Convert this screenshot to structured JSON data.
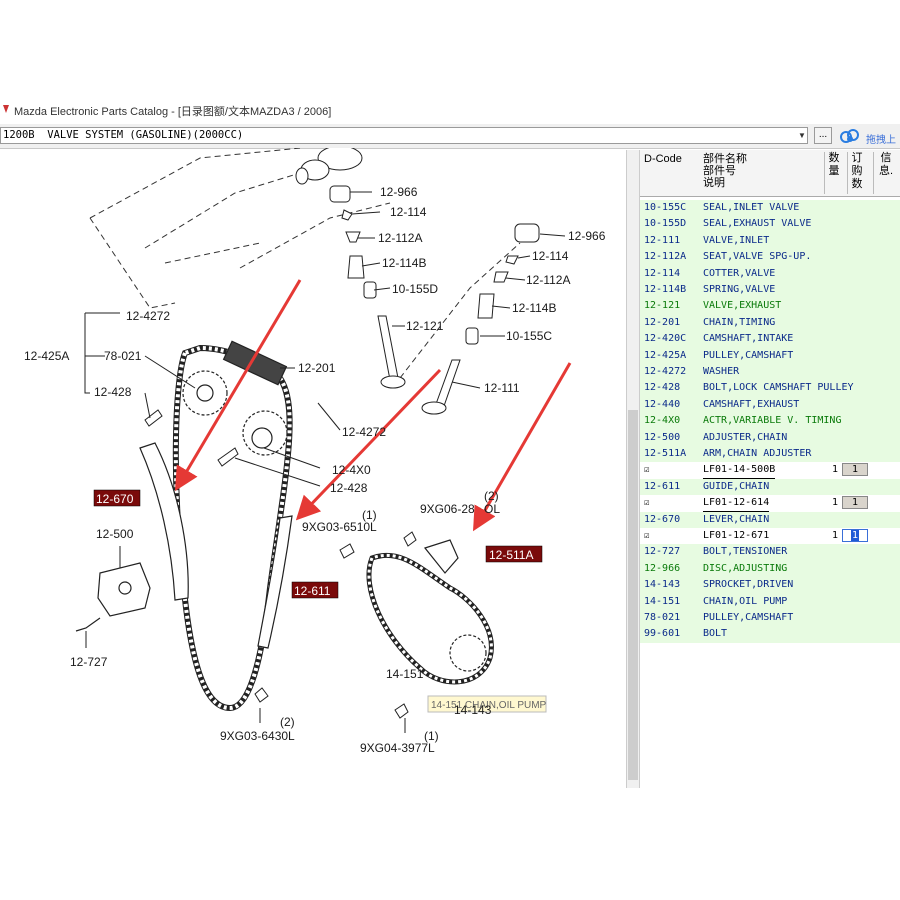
{
  "window": {
    "title": "Mazda Electronic Parts Catalog - [日录图额/文本MAZDA3 / 2006]"
  },
  "toolbar": {
    "section": "1200B  VALVE SYSTEM (GASOLINE)(2000CC)",
    "dots_label": "...",
    "drag_label": "拖拽上"
  },
  "diagram": {
    "labels": [
      "12-966",
      "12-114",
      "12-112A",
      "12-114B",
      "10-155D",
      "12-121",
      "12-966",
      "12-114",
      "12-112A",
      "12-114B",
      "10-155C",
      "12-111",
      "12-4272",
      "12-425A",
      "78-021",
      "12-428",
      "12-201",
      "12-4272",
      "12-4X0",
      "12-428",
      "12-670",
      "12-500",
      "12-727",
      "9XG06-28",
      "(2)",
      "OL",
      "(1)",
      "9XG03-6510L",
      "12-511A",
      "12-611",
      "14-151",
      "14-143",
      "(2)",
      "9XG03-6430L",
      "(1)",
      "9XG04-3977L"
    ],
    "tooltip": "14-151 CHAIN,OIL PUMP"
  },
  "parts_list": {
    "headers": {
      "dcode": "D-Code",
      "name_line1": "部件名称",
      "name_line2": "部件号",
      "name_line3": "说明",
      "qty": "数量",
      "order": "订购数",
      "info": "信息."
    },
    "rows": [
      {
        "code": "10-155C",
        "name": "SEAL,INLET VALVE",
        "color": "blue"
      },
      {
        "code": "10-155D",
        "name": "SEAL,EXHAUST VALVE",
        "color": "blue"
      },
      {
        "code": "12-111",
        "name": "VALVE,INLET",
        "color": "blue"
      },
      {
        "code": "12-112A",
        "name": "SEAT,VALVE SPG-UP.",
        "color": "blue"
      },
      {
        "code": "12-114",
        "name": "COTTER,VALVE",
        "color": "blue"
      },
      {
        "code": "12-114B",
        "name": "SPRING,VALVE",
        "color": "blue"
      },
      {
        "code": "12-121",
        "name": "VALVE,EXHAUST",
        "color": "green"
      },
      {
        "code": "12-201",
        "name": "CHAIN,TIMING",
        "color": "blue"
      },
      {
        "code": "12-420C",
        "name": "CAMSHAFT,INTAKE",
        "color": "blue"
      },
      {
        "code": "12-425A",
        "name": "PULLEY,CAMSHAFT",
        "color": "blue"
      },
      {
        "code": "12-4272",
        "name": "WASHER",
        "color": "blue"
      },
      {
        "code": "12-428",
        "name": "BOLT,LOCK CAMSHAFT PULLEY",
        "color": "blue"
      },
      {
        "code": "12-440",
        "name": "CAMSHAFT,EXHAUST",
        "color": "blue"
      },
      {
        "code": "12-4X0",
        "name": "ACTR,VARIABLE V. TIMING",
        "color": "green"
      },
      {
        "code": "12-500",
        "name": "ADJUSTER,CHAIN",
        "color": "blue"
      },
      {
        "code": "12-511A",
        "name": "ARM,CHAIN ADJUSTER",
        "color": "blue"
      },
      {
        "sub": true,
        "check": "☑",
        "part": "LF01-14-500B",
        "qty": "1",
        "order": "1"
      },
      {
        "code": "12-611",
        "name": "GUIDE,CHAIN",
        "color": "blue"
      },
      {
        "sub": true,
        "check": "☑",
        "part": "LF01-12-614",
        "qty": "1",
        "order": "1"
      },
      {
        "code": "12-670",
        "name": "LEVER,CHAIN",
        "color": "blue"
      },
      {
        "sub": true,
        "check": "☑",
        "part": "LF01-12-671",
        "qty": "1",
        "order": "1",
        "editing": true
      },
      {
        "code": "12-727",
        "name": "BOLT,TENSIONER",
        "color": "blue"
      },
      {
        "code": "12-966",
        "name": "DISC,ADJUSTING",
        "color": "green"
      },
      {
        "code": "14-143",
        "name": "SPROCKET,DRIVEN",
        "color": "blue"
      },
      {
        "code": "14-151",
        "name": "CHAIN,OIL PUMP",
        "color": "blue"
      },
      {
        "code": "78-021",
        "name": "PULLEY,CAMSHAFT",
        "color": "blue"
      },
      {
        "code": "99-601",
        "name": "BOLT",
        "color": "blue"
      }
    ]
  },
  "colors": {
    "arrow": "#e53935",
    "highlight": "#7a0a0a",
    "list_bg": "#e7fbe1",
    "blue_text": "#0b2a8a",
    "green_text": "#0a7a0a"
  }
}
